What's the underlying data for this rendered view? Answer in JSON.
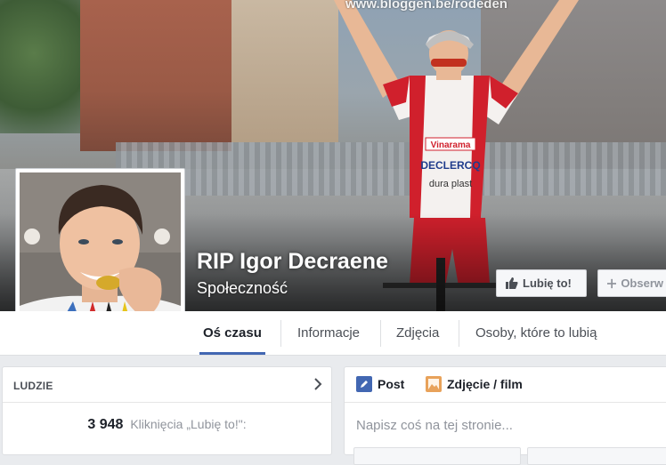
{
  "cover": {
    "watermark": "www.bloggen.be/rodeden",
    "sign_text": ""
  },
  "page": {
    "name": "RIP Igor Decraene",
    "category": "Społeczność"
  },
  "actions": {
    "like_label": "Lubię to!",
    "follow_label": "Obserw"
  },
  "nav": {
    "tabs": [
      {
        "label": "Oś czasu",
        "active": true
      },
      {
        "label": "Informacje",
        "active": false
      },
      {
        "label": "Zdjęcia",
        "active": false
      },
      {
        "label": "Osoby, które to lubią",
        "active": false
      }
    ]
  },
  "people": {
    "title": "LUDZIE",
    "likes_count": "3 948",
    "likes_text": "Kliknięcia „Lubię to!\":"
  },
  "composer": {
    "post_tab": "Post",
    "photo_tab": "Zdjęcie / film",
    "placeholder": "Napisz coś na tej stronie..."
  },
  "colors": {
    "accent": "#4267b2",
    "jersey_red": "#d0202c",
    "background": "#e9ebee"
  }
}
